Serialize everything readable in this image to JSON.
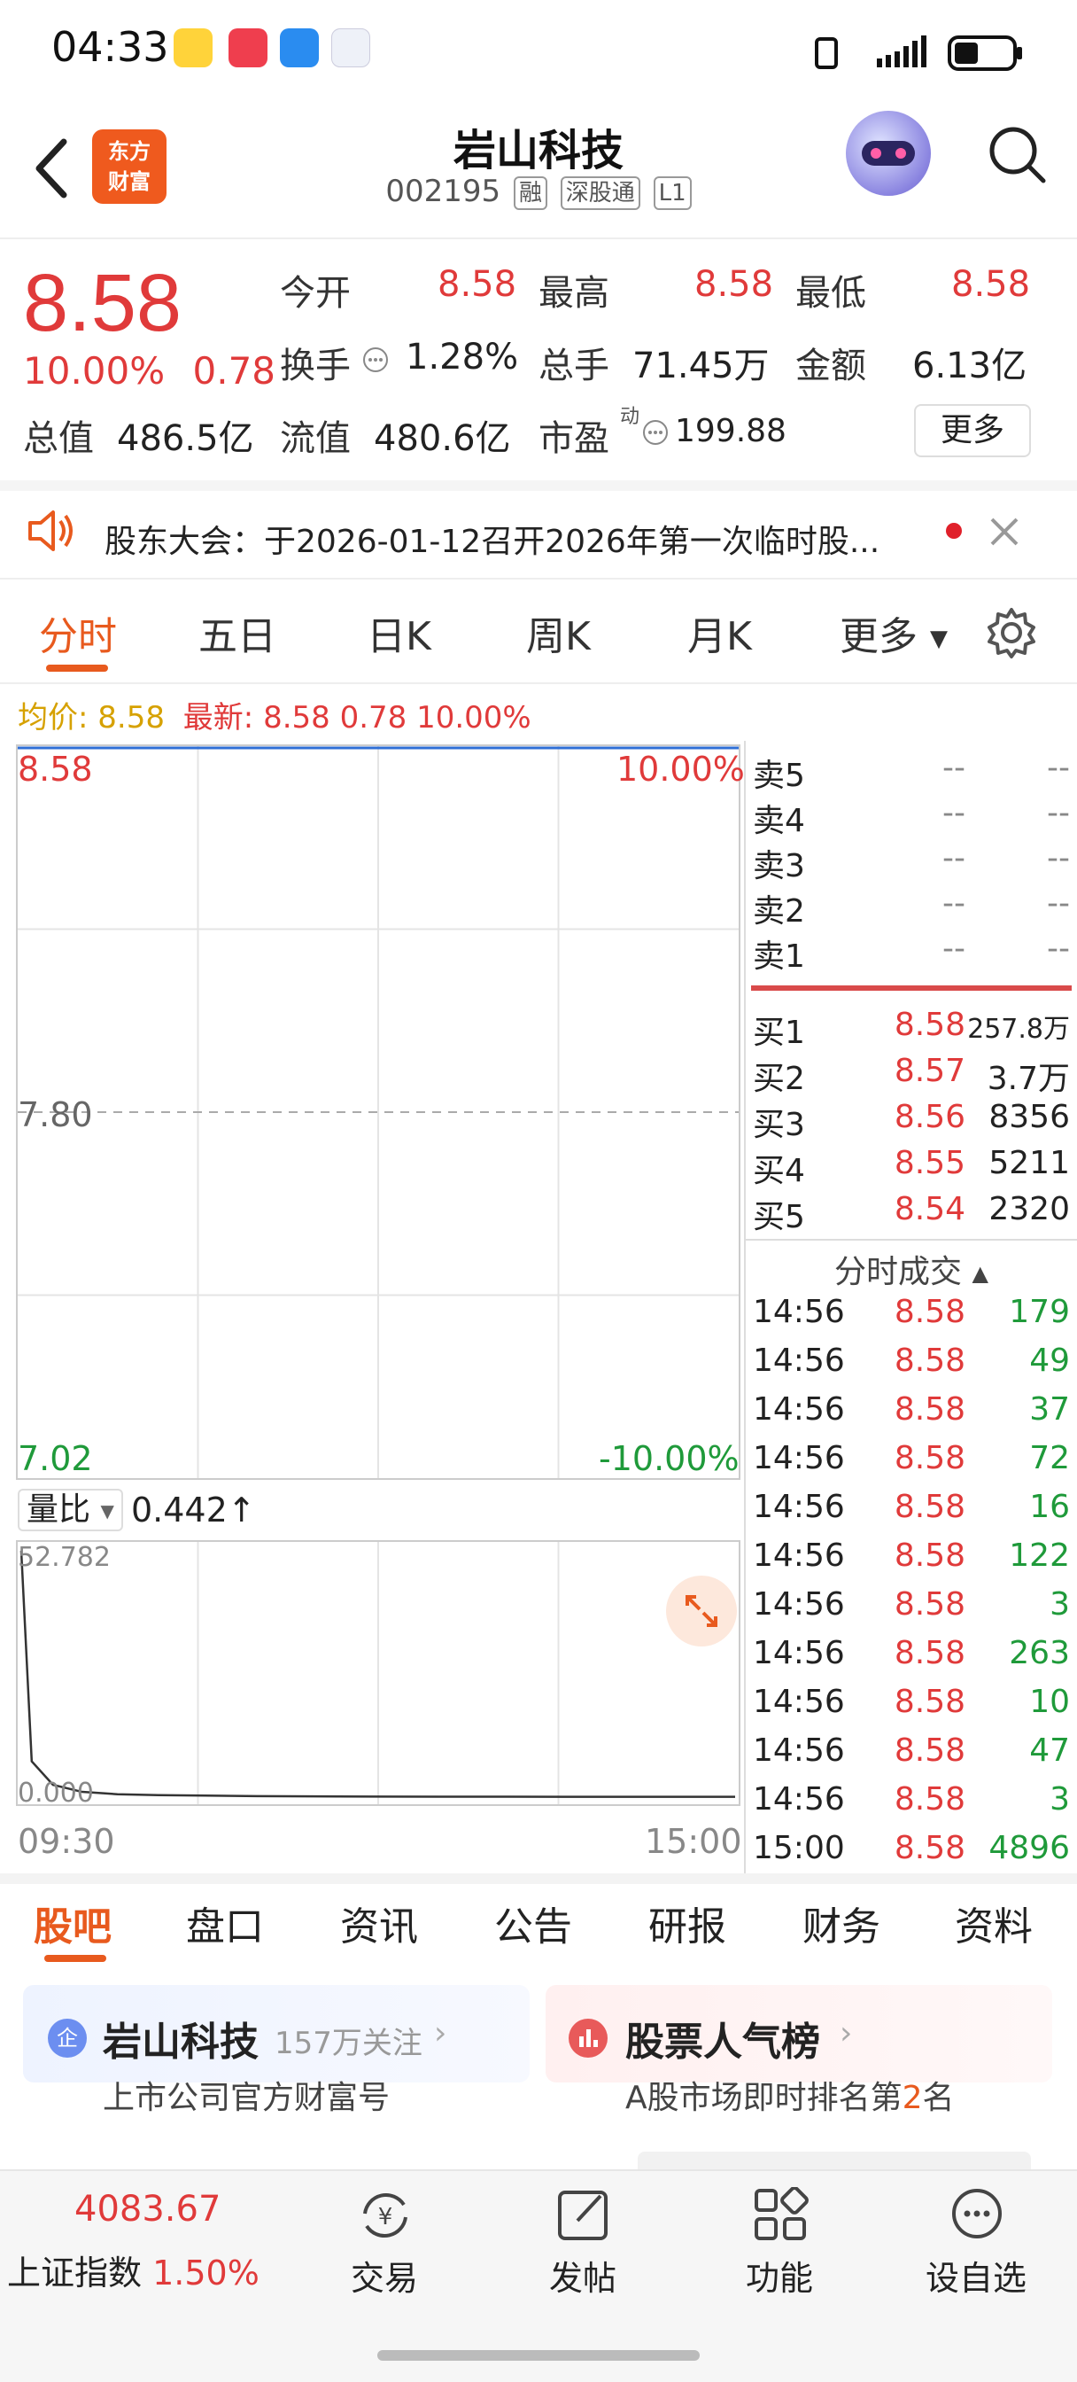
{
  "status_bar": {
    "time": "04:33"
  },
  "header": {
    "logo_text_1": "东方",
    "logo_text_2": "财富",
    "stock_name": "岩山科技",
    "stock_code": "002195",
    "tags": [
      "融",
      "深股通",
      "L1"
    ]
  },
  "quote": {
    "price": "8.58",
    "change_pct": "10.00%",
    "change_amt": "0.78",
    "labels": {
      "open": "今开",
      "high": "最高",
      "low": "最低",
      "turnover": "换手",
      "volume": "总手",
      "amount": "金额",
      "mktcap": "总值",
      "float_cap": "流值",
      "pe": "市盈",
      "pe_sup": "动",
      "more": "更多"
    },
    "values": {
      "open": "8.58",
      "high": "8.58",
      "low": "8.58",
      "turnover": "1.28%",
      "volume": "71.45万",
      "amount": "6.13亿",
      "mktcap": "486.5亿",
      "float_cap": "480.6亿",
      "pe": "199.88"
    }
  },
  "notice": {
    "text": "股东大会：于2026-01-12召开2026年第一次临时股..."
  },
  "chart_tabs": [
    "分时",
    "五日",
    "日K",
    "周K",
    "月K",
    "更多"
  ],
  "chart_info": {
    "avg_label": "均价:",
    "avg_value": "8.58",
    "latest_label": "最新:",
    "latest_value": "8.58 0.78 10.00%"
  },
  "chart_data": {
    "type": "line",
    "price_axis": {
      "top": "8.58",
      "mid": "7.80",
      "bottom": "7.02"
    },
    "pct_axis": {
      "top": "10.00%",
      "bottom": "-10.00%"
    },
    "x_labels": [
      "09:30",
      "15:00"
    ],
    "volume_ratio_label": "量比",
    "volume_ratio_value": "0.442",
    "volume_ratio_max": "52.782",
    "volume_ratio_min": "0.000",
    "price_series": [
      8.58,
      8.58
    ],
    "volume_ratio_series": [
      52.782,
      8,
      3,
      1.5,
      1,
      0.8,
      0.7,
      0.6,
      0.55,
      0.5,
      0.48,
      0.46,
      0.45,
      0.44,
      0.442
    ]
  },
  "order_book": {
    "asks": [
      {
        "label": "卖5",
        "price": "--",
        "vol": "--"
      },
      {
        "label": "卖4",
        "price": "--",
        "vol": "--"
      },
      {
        "label": "卖3",
        "price": "--",
        "vol": "--"
      },
      {
        "label": "卖2",
        "price": "--",
        "vol": "--"
      },
      {
        "label": "卖1",
        "price": "--",
        "vol": "--"
      }
    ],
    "bids": [
      {
        "label": "买1",
        "price": "8.58",
        "vol": "257.8万"
      },
      {
        "label": "买2",
        "price": "8.57",
        "vol": "3.7万"
      },
      {
        "label": "买3",
        "price": "8.56",
        "vol": "8356"
      },
      {
        "label": "买4",
        "price": "8.55",
        "vol": "5211"
      },
      {
        "label": "买5",
        "price": "8.54",
        "vol": "2320"
      }
    ],
    "ticks_header": "分时成交",
    "ticks": [
      {
        "time": "14:56",
        "price": "8.58",
        "vol": "179"
      },
      {
        "time": "14:56",
        "price": "8.58",
        "vol": "49"
      },
      {
        "time": "14:56",
        "price": "8.58",
        "vol": "37"
      },
      {
        "time": "14:56",
        "price": "8.58",
        "vol": "72"
      },
      {
        "time": "14:56",
        "price": "8.58",
        "vol": "16"
      },
      {
        "time": "14:56",
        "price": "8.58",
        "vol": "122"
      },
      {
        "time": "14:56",
        "price": "8.58",
        "vol": "3"
      },
      {
        "time": "14:56",
        "price": "8.58",
        "vol": "263"
      },
      {
        "time": "14:56",
        "price": "8.58",
        "vol": "10"
      },
      {
        "time": "14:56",
        "price": "8.58",
        "vol": "47"
      },
      {
        "time": "14:56",
        "price": "8.58",
        "vol": "3"
      },
      {
        "time": "15:00",
        "price": "8.58",
        "vol": "4896"
      }
    ]
  },
  "section_tabs": [
    "股吧",
    "盘口",
    "资讯",
    "公告",
    "研报",
    "财务",
    "资料"
  ],
  "cards": {
    "left_title": "岩山科技",
    "left_follow": "157万关注",
    "left_sub": "上市公司官方财富号",
    "left_badge": "企",
    "right_title": "股票人气榜",
    "right_sub_1": "A股市场即时排名第",
    "right_rank": "2",
    "right_sub_2": "名"
  },
  "bottom_nav": {
    "index_value": "4083.67",
    "index_name": "上证指数",
    "index_change": "1.50%",
    "items": [
      "交易",
      "发帖",
      "功能",
      "设自选"
    ]
  },
  "colors": {
    "up": "#e03a3a",
    "down": "#1f9a3a",
    "accent": "#e85a1e"
  }
}
